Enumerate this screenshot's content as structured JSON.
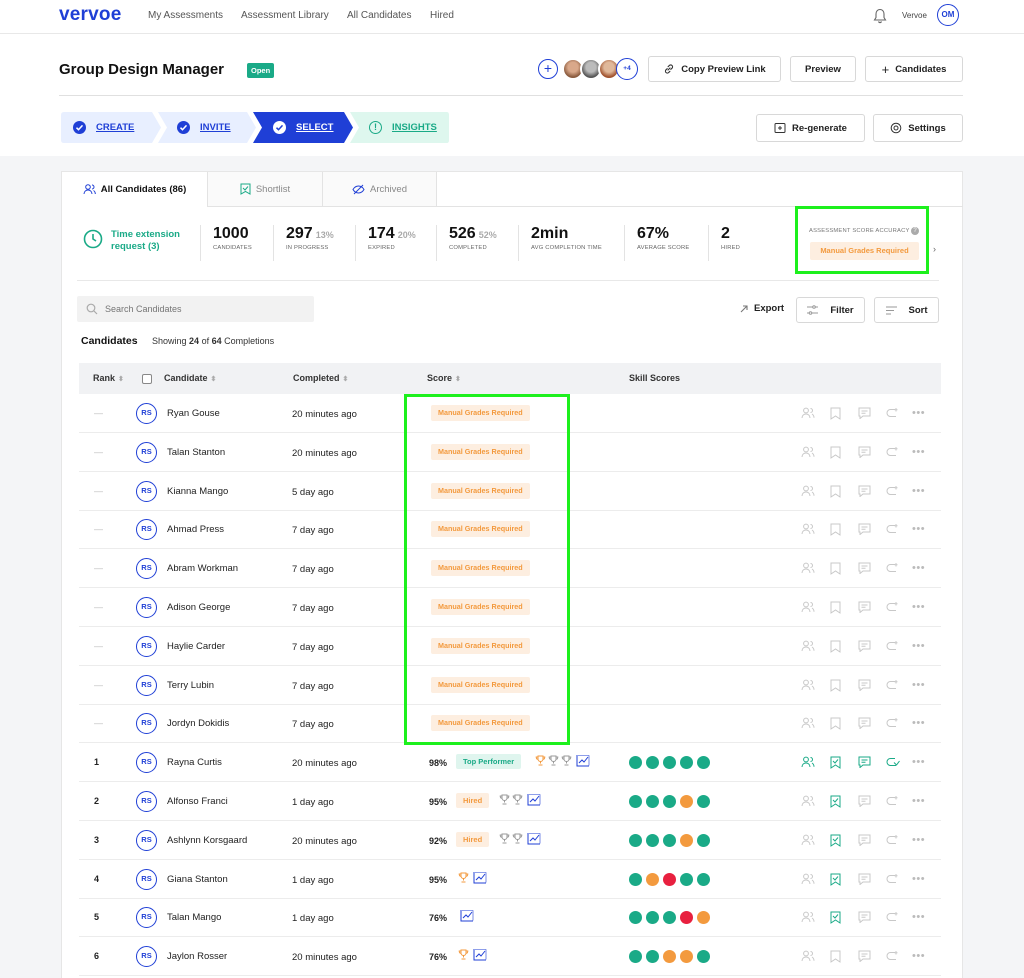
{
  "nav": {
    "logo": "vervoe",
    "links": [
      "My Assessments",
      "Assessment Library",
      "All Candidates",
      "Hired"
    ],
    "user_label": "Vervoe",
    "user_initials": "OM"
  },
  "job": {
    "title": "Group Design Manager",
    "status": "Open",
    "more_members": "+4"
  },
  "header_buttons": {
    "copy_preview": "Copy Preview Link",
    "preview": "Preview",
    "candidates": "Candidates",
    "regenerate": "Re-generate",
    "settings": "Settings"
  },
  "steps": [
    {
      "label": "CREATE"
    },
    {
      "label": "INVITE"
    },
    {
      "label": "SELECT"
    },
    {
      "label": "INSIGHTS"
    }
  ],
  "tabs": {
    "all": "All Candidates (86)",
    "shortlist": "Shortlist",
    "archived": "Archived"
  },
  "time_extension": "Time extension request (3)",
  "stats": [
    {
      "num": "1000",
      "pct": "",
      "label": "CANDIDATES"
    },
    {
      "num": "297",
      "pct": "13%",
      "label": "IN PROGRESS"
    },
    {
      "num": "174",
      "pct": "20%",
      "label": "EXPIRED"
    },
    {
      "num": "526",
      "pct": "52%",
      "label": "COMPLETED"
    },
    {
      "num": "2min",
      "pct": "",
      "label": "AVG COMPLETION TIME"
    },
    {
      "num": "67%",
      "pct": "",
      "label": "AVERAGE SCORE"
    },
    {
      "num": "2",
      "pct": "",
      "label": "HIRED"
    }
  ],
  "accuracy": {
    "title": "ASSESSMENT SCORE ACCURACY",
    "badge": "Manual Grades Required",
    "help": "?"
  },
  "toolbar": {
    "search_placeholder": "Search Candidates",
    "export": "Export",
    "filter": "Filter",
    "sort": "Sort"
  },
  "candidates_title": "Candidates",
  "showing": {
    "prefix": "Showing",
    "shown": "24",
    "of": "of",
    "total": "64",
    "suffix": "Completions"
  },
  "columns": {
    "rank": "Rank",
    "candidate": "Candidate",
    "completed": "Completed",
    "score": "Score",
    "skills": "Skill Scores"
  },
  "colors": {
    "brand": "#1f3fd6",
    "green": "#1aaa87",
    "orange": "#f39a3e",
    "red": "#e8203f",
    "highlight": "#1df01d"
  },
  "pending": [
    {
      "rank": "—",
      "initials": "RS",
      "name": "Ryan Gouse",
      "completed": "20 minutes ago",
      "score": "Manual Grades Required"
    },
    {
      "rank": "—",
      "initials": "RS",
      "name": "Talan Stanton",
      "completed": "20 minutes ago",
      "score": "Manual Grades Required"
    },
    {
      "rank": "—",
      "initials": "RS",
      "name": "Kianna Mango",
      "completed": "5 day ago",
      "score": "Manual Grades Required"
    },
    {
      "rank": "—",
      "initials": "RS",
      "name": "Ahmad Press",
      "completed": "7 day ago",
      "score": "Manual Grades Required"
    },
    {
      "rank": "—",
      "initials": "RS",
      "name": "Abram Workman",
      "completed": "7 day ago",
      "score": "Manual Grades Required"
    },
    {
      "rank": "—",
      "initials": "RS",
      "name": "Adison George",
      "completed": "7 day ago",
      "score": "Manual Grades Required"
    },
    {
      "rank": "—",
      "initials": "RS",
      "name": "Haylie Carder",
      "completed": "7 day ago",
      "score": "Manual Grades Required"
    },
    {
      "rank": "—",
      "initials": "RS",
      "name": "Terry Lubin",
      "completed": "7 day ago",
      "score": "Manual Grades Required"
    },
    {
      "rank": "—",
      "initials": "RS",
      "name": "Jordyn Dokidis",
      "completed": "7 day ago",
      "score": "Manual Grades Required"
    }
  ],
  "ranked": [
    {
      "rank": "1",
      "initials": "RS",
      "name": "Rayna Curtis",
      "completed": "20 minutes ago",
      "score": "98%",
      "badge": "Top Performer",
      "trophies": 3,
      "skills": [
        "g",
        "g",
        "g",
        "g",
        "g"
      ],
      "active": [
        true,
        true,
        true,
        true
      ]
    },
    {
      "rank": "2",
      "initials": "RS",
      "name": "Alfonso Franci",
      "completed": "1 day ago",
      "score": "95%",
      "badge": "Hired",
      "trophies": 2,
      "skills": [
        "g",
        "g",
        "g",
        "o",
        "g"
      ],
      "active": [
        false,
        true,
        false,
        false
      ]
    },
    {
      "rank": "3",
      "initials": "RS",
      "name": "Ashlynn Korsgaard",
      "completed": "20 minutes ago",
      "score": "92%",
      "badge": "Hired",
      "trophies": 2,
      "skills": [
        "g",
        "g",
        "g",
        "o",
        "g"
      ],
      "active": [
        false,
        true,
        false,
        false
      ]
    },
    {
      "rank": "4",
      "initials": "RS",
      "name": "Giana Stanton",
      "completed": "1 day ago",
      "score": "95%",
      "badge": "",
      "trophies": 1,
      "skills": [
        "g",
        "o",
        "r",
        "g",
        "g"
      ],
      "active": [
        false,
        true,
        false,
        false
      ]
    },
    {
      "rank": "5",
      "initials": "RS",
      "name": "Talan Mango",
      "completed": "1 day ago",
      "score": "76%",
      "badge": "",
      "trophies": 0,
      "skills": [
        "g",
        "g",
        "g",
        "r",
        "o"
      ],
      "active": [
        false,
        true,
        false,
        false
      ]
    },
    {
      "rank": "6",
      "initials": "RS",
      "name": "Jaylon Rosser",
      "completed": "20 minutes ago",
      "score": "76%",
      "badge": "",
      "trophies": 1,
      "skills": [
        "g",
        "g",
        "o",
        "o",
        "g"
      ],
      "active": [
        false,
        false,
        false,
        false
      ]
    }
  ]
}
